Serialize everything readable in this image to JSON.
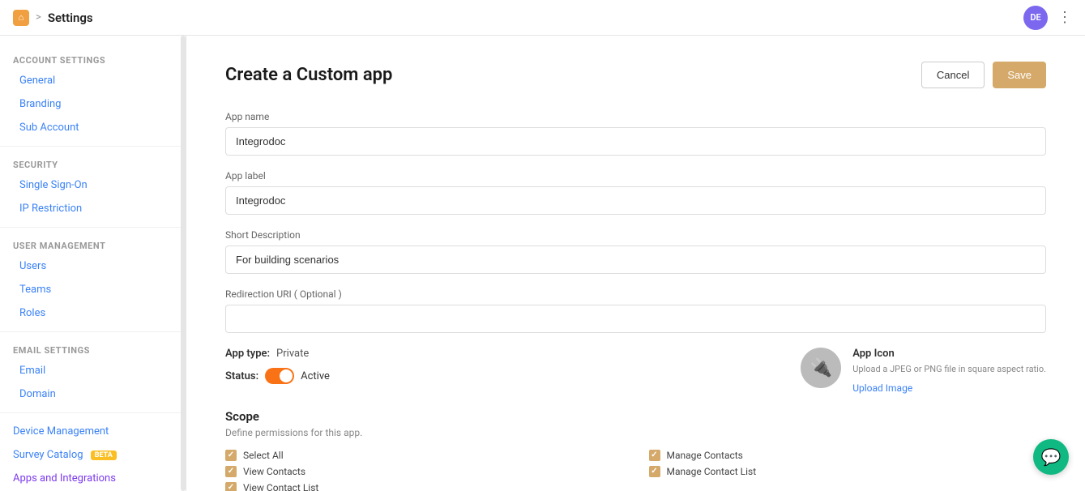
{
  "topnav": {
    "home_icon": "⌂",
    "separator": ">",
    "title": "Settings",
    "avatar_initials": "DE",
    "dots": "⋮"
  },
  "sidebar": {
    "account_settings_label": "ACCOUNT SETTINGS",
    "general_label": "General",
    "branding_label": "Branding",
    "subaccount_label": "Sub Account",
    "security_label": "SECURITY",
    "sso_label": "Single Sign-On",
    "ip_restriction_label": "IP Restriction",
    "user_management_label": "USER MANAGEMENT",
    "users_label": "Users",
    "teams_label": "Teams",
    "roles_label": "Roles",
    "email_settings_label": "EMAIL SETTINGS",
    "email_label": "Email",
    "domain_label": "Domain",
    "device_management_label": "Device Management",
    "survey_catalog_label": "Survey Catalog",
    "survey_catalog_badge": "BETA",
    "apps_integrations_label": "Apps and Integrations"
  },
  "main": {
    "page_title": "Create a Custom app",
    "cancel_label": "Cancel",
    "save_label": "Save",
    "app_name_label": "App name",
    "app_name_value": "Integrodoc",
    "app_label_label": "App label",
    "app_label_value": "Integrodoc",
    "short_desc_label": "Short Description",
    "short_desc_value": "For building scenarios",
    "redirect_uri_label": "Redirection URI ( Optional )",
    "redirect_uri_value": "",
    "app_type_label": "App type:",
    "app_type_value": "Private",
    "status_label": "Status:",
    "status_active": "Active",
    "app_icon_title": "App Icon",
    "app_icon_desc": "Upload a JPEG or PNG file in square aspect ratio.",
    "upload_image_label": "Upload Image",
    "scope_title": "Scope",
    "scope_desc": "Define permissions for this app.",
    "scope_items_left": [
      "Select All",
      "View Contacts",
      "View Contact List"
    ],
    "scope_items_right": [
      "Manage Contacts",
      "Manage Contact List"
    ]
  },
  "colors": {
    "accent": "#d4a96a",
    "blue": "#3b82f6",
    "toggle_bg": "#f97316"
  }
}
